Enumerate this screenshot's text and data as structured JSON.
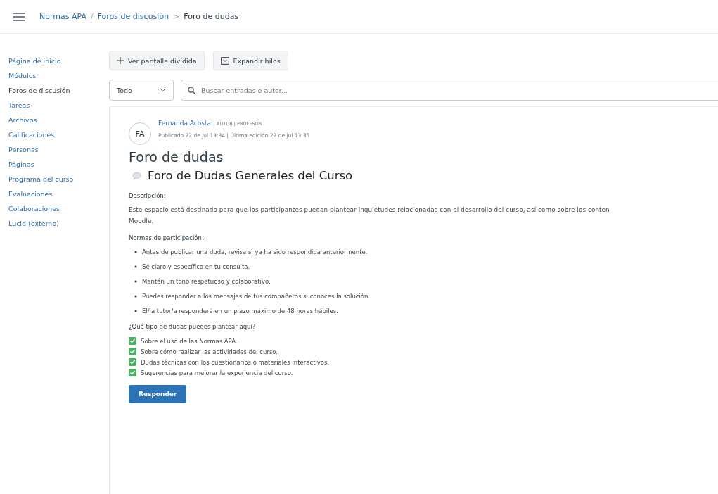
{
  "breadcrumb": [
    {
      "label": "Normas APA",
      "kind": "link"
    },
    {
      "label": "/",
      "kind": "sep"
    },
    {
      "label": "Foros de discusión",
      "kind": "link"
    },
    {
      "label": ">",
      "kind": "sep"
    },
    {
      "label": "Foro de dudas",
      "kind": "current"
    }
  ],
  "sidebar": {
    "items": [
      {
        "label": "Página de inicio",
        "selected": false
      },
      {
        "label": "Módulos",
        "selected": false
      },
      {
        "label": "Foros de discusión",
        "selected": true
      },
      {
        "label": "Tareas",
        "selected": false
      },
      {
        "label": "Archivos",
        "selected": false
      },
      {
        "label": "Calificaciones",
        "selected": false
      },
      {
        "label": "Personas",
        "selected": false
      },
      {
        "label": "Páginas",
        "selected": false
      },
      {
        "label": "Programa del curso",
        "selected": false
      },
      {
        "label": "Evaluaciones",
        "selected": false
      },
      {
        "label": "Colaboraciones",
        "selected": false
      },
      {
        "label": "Lucid (externo)",
        "selected": false
      }
    ]
  },
  "toolbar": {
    "split_button": "Ver pantalla dividida",
    "expand_button": "Expandir hilos",
    "filter": {
      "value": "Todo"
    },
    "search": {
      "placeholder": "Buscar entradas o autor..."
    }
  },
  "post": {
    "avatar": "FA",
    "author": "Fernanda Acosta",
    "roles": "AUTOR | PROFESOR",
    "meta": "Publicado 22 de jul 13:34 | Última edición 22 de jul 13:35",
    "title": "Foro de dudas",
    "heading": "Foro de Dudas Generales del Curso",
    "description_label": "Descripción:",
    "description_lines": [
      "Este espacio está destinado para que los participantes puedan plantear inquietudes relacionadas con el desarrollo del curso, así como sobre los conten",
      "Moodle."
    ],
    "rules_label": "Normas de participación:",
    "rules": [
      "Antes de publicar una duda, revisa si ya ha sido respondida anteriormente.",
      "Sé claro y específico en tu consulta.",
      "Mantén un tono respetuoso y colaborativo.",
      "Puedes responder a los mensajes de tus compañeros si conoces la solución.",
      "El/la tutor/a responderá en un plazo máximo de 48 horas hábiles."
    ],
    "topics_label": "¿Qué tipo de dudas puedes plantear aquí?",
    "topics": [
      "Sobre el uso de las Normas APA.",
      "Sobre cómo realizar las actividades del curso.",
      "Dudas técnicas con los cuestionarios o materiales interactivos.",
      "Sugerencias para mejorar la experiencia del curso."
    ],
    "reply_button": "Responder"
  }
}
